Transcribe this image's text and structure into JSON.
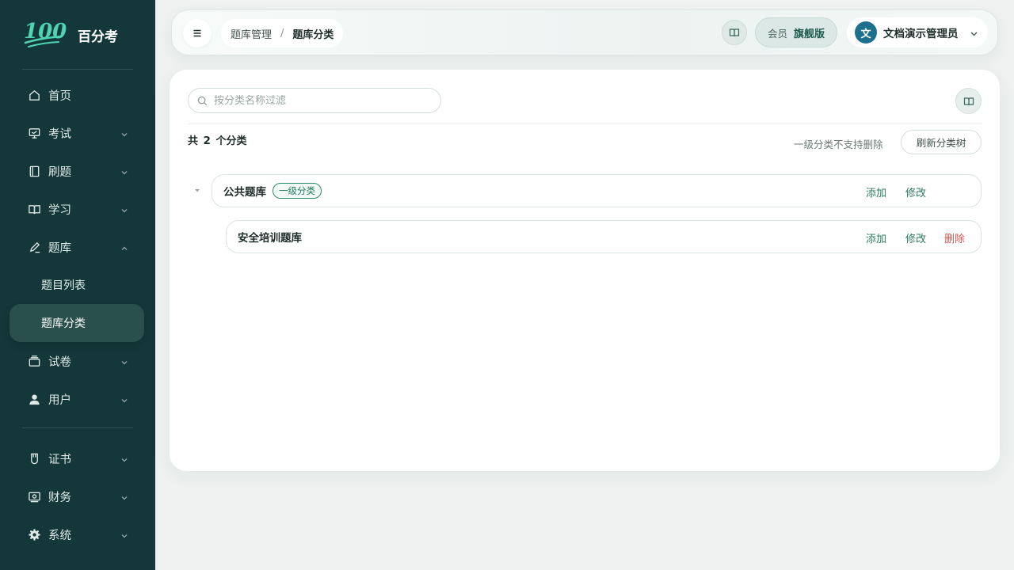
{
  "app": {
    "logo_mark": "100",
    "name": "百分考"
  },
  "sidebar": {
    "items": [
      {
        "label": "首页",
        "icon": "home-icon"
      },
      {
        "label": "考试",
        "icon": "exam-icon"
      },
      {
        "label": "刷题",
        "icon": "notebook-icon"
      },
      {
        "label": "学习",
        "icon": "book-open-icon"
      },
      {
        "label": "题库",
        "icon": "edit-icon"
      },
      {
        "label": "试卷",
        "icon": "paper-stack-icon"
      },
      {
        "label": "用户",
        "icon": "user-icon"
      },
      {
        "label": "证书",
        "icon": "certificate-icon"
      },
      {
        "label": "财务",
        "icon": "finance-icon"
      },
      {
        "label": "系统",
        "icon": "settings-icon"
      }
    ],
    "sub_items": [
      {
        "label": "题目列表"
      },
      {
        "label": "题库分类",
        "active": true
      }
    ]
  },
  "header": {
    "breadcrumb": [
      "题库管理",
      "题库分类"
    ],
    "separator": "/",
    "member_label": "会员",
    "member_tier": "旗舰版",
    "avatar_text": "文",
    "user_name": "文档演示管理员"
  },
  "main": {
    "search_placeholder": "按分类名称过滤",
    "count_prefix": "共",
    "count_value": "2",
    "count_suffix": "个分类",
    "hint": "一级分类不支持删除",
    "refresh_label": "刷新分类树",
    "tree": [
      {
        "name": "公共题库",
        "tag": "一级分类",
        "actions": [
          "添加",
          "修改"
        ]
      },
      {
        "name": "安全培训题库",
        "actions": [
          "添加",
          "修改",
          "删除"
        ]
      }
    ]
  },
  "colors": {
    "sidebar_bg": "#14383a",
    "accent": "#2a7a5f",
    "danger": "#d9534f",
    "avatar_bg": "#1d6f8e"
  }
}
